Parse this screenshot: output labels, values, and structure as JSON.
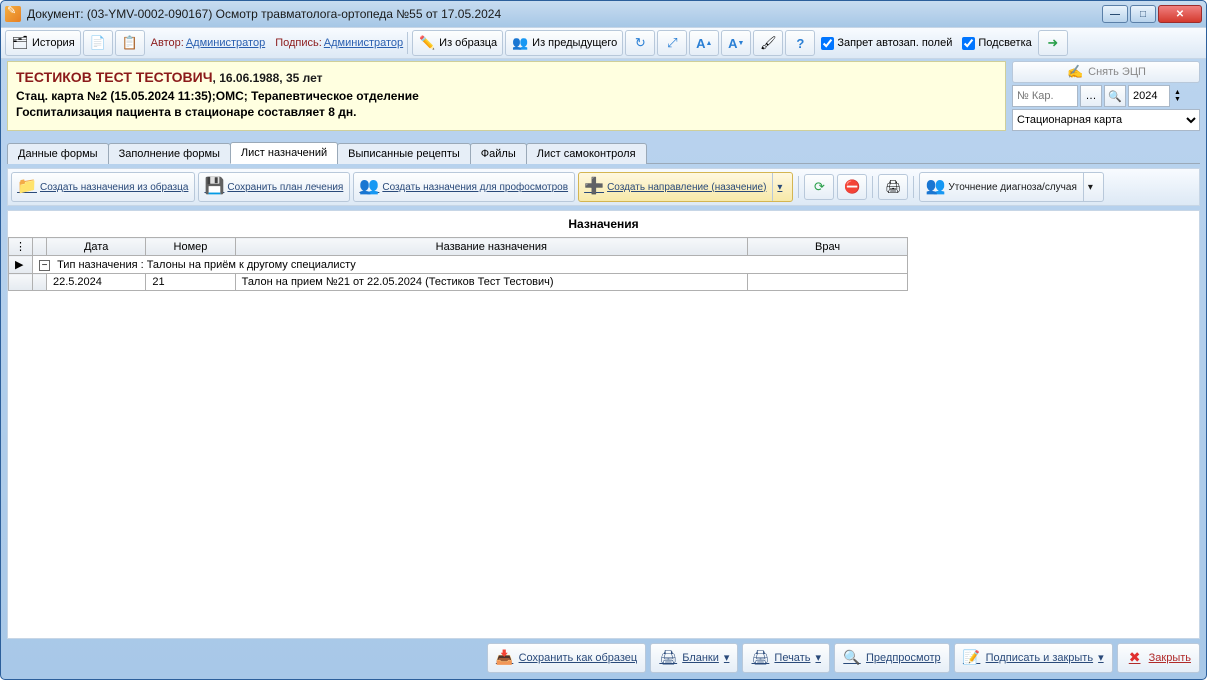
{
  "window": {
    "title": "Документ: (03-YMV-0002-090167) Осмотр травматолога-ортопеда №55 от 17.05.2024"
  },
  "toolbar": {
    "history": "История",
    "author_label": "Автор:",
    "author_value": "Администратор",
    "sign_label": "Подпись:",
    "sign_value": "Администратор",
    "from_template": "Из образца",
    "from_previous": "Из предыдущего",
    "block_autofill": "Запрет автозап. полей",
    "highlight": "Подсветка"
  },
  "patient": {
    "name": "ТЕСТИКОВ ТЕСТ ТЕСТОВИЧ",
    "demo": ", 16.06.1988, 35 лет",
    "line2": "Стац. карта №2 (15.05.2024 11:35);ОМС; Терапевтическое отделение",
    "line3": "Госпитализация пациента в стационаре составляет 8 дн."
  },
  "rightpanel": {
    "remove_sig": "Снять ЭЦП",
    "card_no_placeholder": "№ Кар.",
    "year": "2024",
    "card_type": "Стационарная карта"
  },
  "tabs": {
    "t1": "Данные формы",
    "t2": "Заполнение формы",
    "t3": "Лист назначений",
    "t4": "Выписанные рецепты",
    "t5": "Файлы",
    "t6": "Лист самоконтроля"
  },
  "sub": {
    "b1": "Создать назначения из образца",
    "b2": "Сохранить план лечения",
    "b3": "Создать назначения для профосмотров",
    "b4": "Создать направление (назачение)",
    "b5": "Уточнение диагноза/случая"
  },
  "grid": {
    "title": "Назначения",
    "col_date": "Дата",
    "col_num": "Номер",
    "col_name": "Название назначения",
    "col_doc": "Врач",
    "group": "Тип назначения : Талоны на приём к другому специалисту",
    "rows": [
      {
        "date": "22.5.2024",
        "num": "21",
        "name": "Талон на прием №21 от 22.05.2024 (Тестиков Тест Тестович)",
        "doc": ""
      }
    ]
  },
  "footer": {
    "save_template": "Сохранить как образец",
    "blanks": "Бланки",
    "print": "Печать",
    "preview": "Предпросмотр",
    "sign_close": "Подписать и закрыть",
    "close": "Закрыть"
  }
}
